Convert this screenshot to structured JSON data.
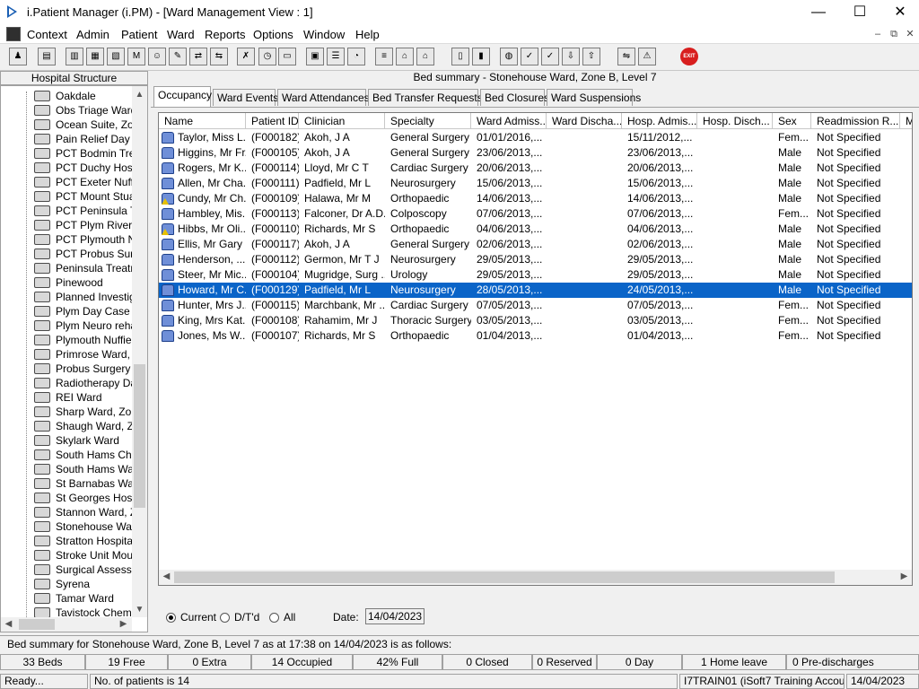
{
  "window": {
    "title": "i.Patient Manager (i.PM) - [Ward Management View : 1]",
    "controls": [
      "—",
      "☐",
      "✕"
    ],
    "mdi_controls": [
      "–",
      "⧉",
      "✕"
    ]
  },
  "menu": [
    "Context",
    "Admin",
    "Patient",
    "Ward",
    "Reports",
    "Options",
    "Window",
    "Help"
  ],
  "toolbar": {
    "exit_label": "EXIT"
  },
  "left_panel": {
    "header": "Hospital Structure",
    "items": [
      "Oakdale",
      "Obs Triage Ward",
      "Ocean Suite, Zor",
      "Pain Relief Day C",
      "PCT Bodmin Trea",
      "PCT Duchy Hosp",
      "PCT Exeter Nuffie",
      "PCT Mount Stuar",
      "PCT Peninsula Tr",
      "PCT Plym River F",
      "PCT Plymouth Nu",
      "PCT Probus Surg",
      "Peninsula Treatm",
      "Pinewood",
      "Planned Investig",
      "Plym Day Case U",
      "Plym Neuro rehab",
      "Plymouth Nuffield",
      "Primrose Ward, Z",
      "Probus Surgery V",
      "Radiotherapy Day",
      "REI Ward",
      "Sharp Ward, Zon",
      "Shaugh Ward, Zo",
      "Skylark Ward",
      "South Hams Cher",
      "South Hams War",
      "St Barnabas War",
      "St Georges Hosp",
      "Stannon Ward, Z",
      "Stonehouse Ware",
      "Stratton Hospital",
      "Stroke Unit Moun",
      "Surgical Assessm",
      "Syrena",
      "Tamar Ward",
      "Tavistock Chemc"
    ]
  },
  "right_panel": {
    "header": "Bed summary - Stonehouse Ward, Zone B, Level 7",
    "tabs": [
      "Occupancy",
      "Ward Events",
      "Ward Attendances",
      "Bed Transfer Requests",
      "Bed Closures",
      "Ward Suspensions"
    ],
    "active_tab": "Occupancy",
    "columns": [
      "Name",
      "Patient ID",
      "Clinician",
      "Specialty",
      "Ward Admiss...",
      "Ward Discha...",
      "Hosp. Admis...",
      "Hosp. Disch...",
      "Sex",
      "Readmission R...",
      "M"
    ],
    "rows": [
      {
        "name": "Taylor, Miss L...",
        "id": "(F000182)",
        "clinician": "Akoh, J A",
        "specialty": "General Surgery",
        "ward_adm": "01/01/2016,...",
        "ward_dis": "",
        "hosp_adm": "15/11/2012,...",
        "hosp_dis": "",
        "sex": "Fem...",
        "readm": "Not Specified",
        "icon": "patient"
      },
      {
        "name": "Higgins, Mr Fr...",
        "id": "(F000105)",
        "clinician": "Akoh, J A",
        "specialty": "General Surgery",
        "ward_adm": "23/06/2013,...",
        "ward_dis": "",
        "hosp_adm": "23/06/2013,...",
        "hosp_dis": "",
        "sex": "Male",
        "readm": "Not Specified",
        "icon": "patient"
      },
      {
        "name": "Rogers, Mr K...",
        "id": "(F000114)",
        "clinician": "Lloyd, Mr C T",
        "specialty": "Cardiac Surgery",
        "ward_adm": "20/06/2013,...",
        "ward_dis": "",
        "hosp_adm": "20/06/2013,...",
        "hosp_dis": "",
        "sex": "Male",
        "readm": "Not Specified",
        "icon": "patient"
      },
      {
        "name": "Allen, Mr Cha...",
        "id": "(F000111)",
        "clinician": "Padfield, Mr L",
        "specialty": "Neurosurgery",
        "ward_adm": "15/06/2013,...",
        "ward_dis": "",
        "hosp_adm": "15/06/2013,...",
        "hosp_dis": "",
        "sex": "Male",
        "readm": "Not Specified",
        "icon": "patient"
      },
      {
        "name": "Cundy, Mr Ch...",
        "id": "(F000109)",
        "clinician": "Halawa, Mr M",
        "specialty": "Orthopaedic",
        "ward_adm": "14/06/2013,...",
        "ward_dis": "",
        "hosp_adm": "14/06/2013,...",
        "hosp_dis": "",
        "sex": "Male",
        "readm": "Not Specified",
        "icon": "warning"
      },
      {
        "name": "Hambley, Mis...",
        "id": "(F000113)",
        "clinician": "Falconer, Dr A.D.",
        "specialty": "Colposcopy",
        "ward_adm": "07/06/2013,...",
        "ward_dis": "",
        "hosp_adm": "07/06/2013,...",
        "hosp_dis": "",
        "sex": "Fem...",
        "readm": "Not Specified",
        "icon": "patient"
      },
      {
        "name": "Hibbs, Mr Oli...",
        "id": "(F000110)",
        "clinician": "Richards, Mr S",
        "specialty": "Orthopaedic",
        "ward_adm": "04/06/2013,...",
        "ward_dis": "",
        "hosp_adm": "04/06/2013,...",
        "hosp_dis": "",
        "sex": "Male",
        "readm": "Not Specified",
        "icon": "warning"
      },
      {
        "name": "Ellis, Mr Gary",
        "id": "(F000117)",
        "clinician": "Akoh, J A",
        "specialty": "General Surgery",
        "ward_adm": "02/06/2013,...",
        "ward_dis": "",
        "hosp_adm": "02/06/2013,...",
        "hosp_dis": "",
        "sex": "Male",
        "readm": "Not Specified",
        "icon": "patient"
      },
      {
        "name": "Henderson, ...",
        "id": "(F000112)",
        "clinician": "Germon, Mr T J",
        "specialty": "Neurosurgery",
        "ward_adm": "29/05/2013,...",
        "ward_dis": "",
        "hosp_adm": "29/05/2013,...",
        "hosp_dis": "",
        "sex": "Male",
        "readm": "Not Specified",
        "icon": "patient"
      },
      {
        "name": "Steer, Mr Mic...",
        "id": "(F000104)",
        "clinician": "Mugridge, Surg ...",
        "specialty": "Urology",
        "ward_adm": "29/05/2013,...",
        "ward_dis": "",
        "hosp_adm": "29/05/2013,...",
        "hosp_dis": "",
        "sex": "Male",
        "readm": "Not Specified",
        "icon": "patient"
      },
      {
        "name": "Howard, Mr C...",
        "id": "(F000129)",
        "clinician": "Padfield, Mr L",
        "specialty": "Neurosurgery",
        "ward_adm": "28/05/2013,...",
        "ward_dis": "",
        "hosp_adm": "24/05/2013,...",
        "hosp_dis": "",
        "sex": "Male",
        "readm": "Not Specified",
        "icon": "patient",
        "selected": true
      },
      {
        "name": "Hunter, Mrs J...",
        "id": "(F000115)",
        "clinician": "Marchbank, Mr ...",
        "specialty": "Cardiac Surgery",
        "ward_adm": "07/05/2013,...",
        "ward_dis": "",
        "hosp_adm": "07/05/2013,...",
        "hosp_dis": "",
        "sex": "Fem...",
        "readm": "Not Specified",
        "icon": "patient"
      },
      {
        "name": "King, Mrs Kat...",
        "id": "(F000108)",
        "clinician": "Rahamim, Mr J",
        "specialty": "Thoracic Surgery",
        "ward_adm": "03/05/2013,...",
        "ward_dis": "",
        "hosp_adm": "03/05/2013,...",
        "hosp_dis": "",
        "sex": "Fem...",
        "readm": "Not Specified",
        "icon": "patient"
      },
      {
        "name": "Jones, Ms W...",
        "id": "(F000107)",
        "clinician": "Richards, Mr S",
        "specialty": "Orthopaedic",
        "ward_adm": "01/04/2013,...",
        "ward_dis": "",
        "hosp_adm": "01/04/2013,...",
        "hosp_dis": "",
        "sex": "Fem...",
        "readm": "Not Specified",
        "icon": "patient"
      }
    ],
    "filter": {
      "options": [
        "Current",
        "D/T'd",
        "All"
      ],
      "selected": "Current",
      "date_label": "Date:",
      "date_value": "14/04/2023"
    }
  },
  "summary_line": "Bed summary for Stonehouse Ward, Zone B, Level 7 as at 17:38 on 14/04/2023 is as follows:",
  "stats": [
    "33 Beds",
    "19 Free",
    "0 Extra",
    "14 Occupied",
    "42% Full",
    "0 Closed",
    "0 Reserved",
    "0 Day",
    "1 Home leave",
    "0 Pre-discharges"
  ],
  "statusbar": {
    "ready": "Ready...",
    "patients": "No. of patients is 14",
    "user": "I7TRAIN01 (iSoft7 Training Account)",
    "date": "14/04/2023"
  }
}
